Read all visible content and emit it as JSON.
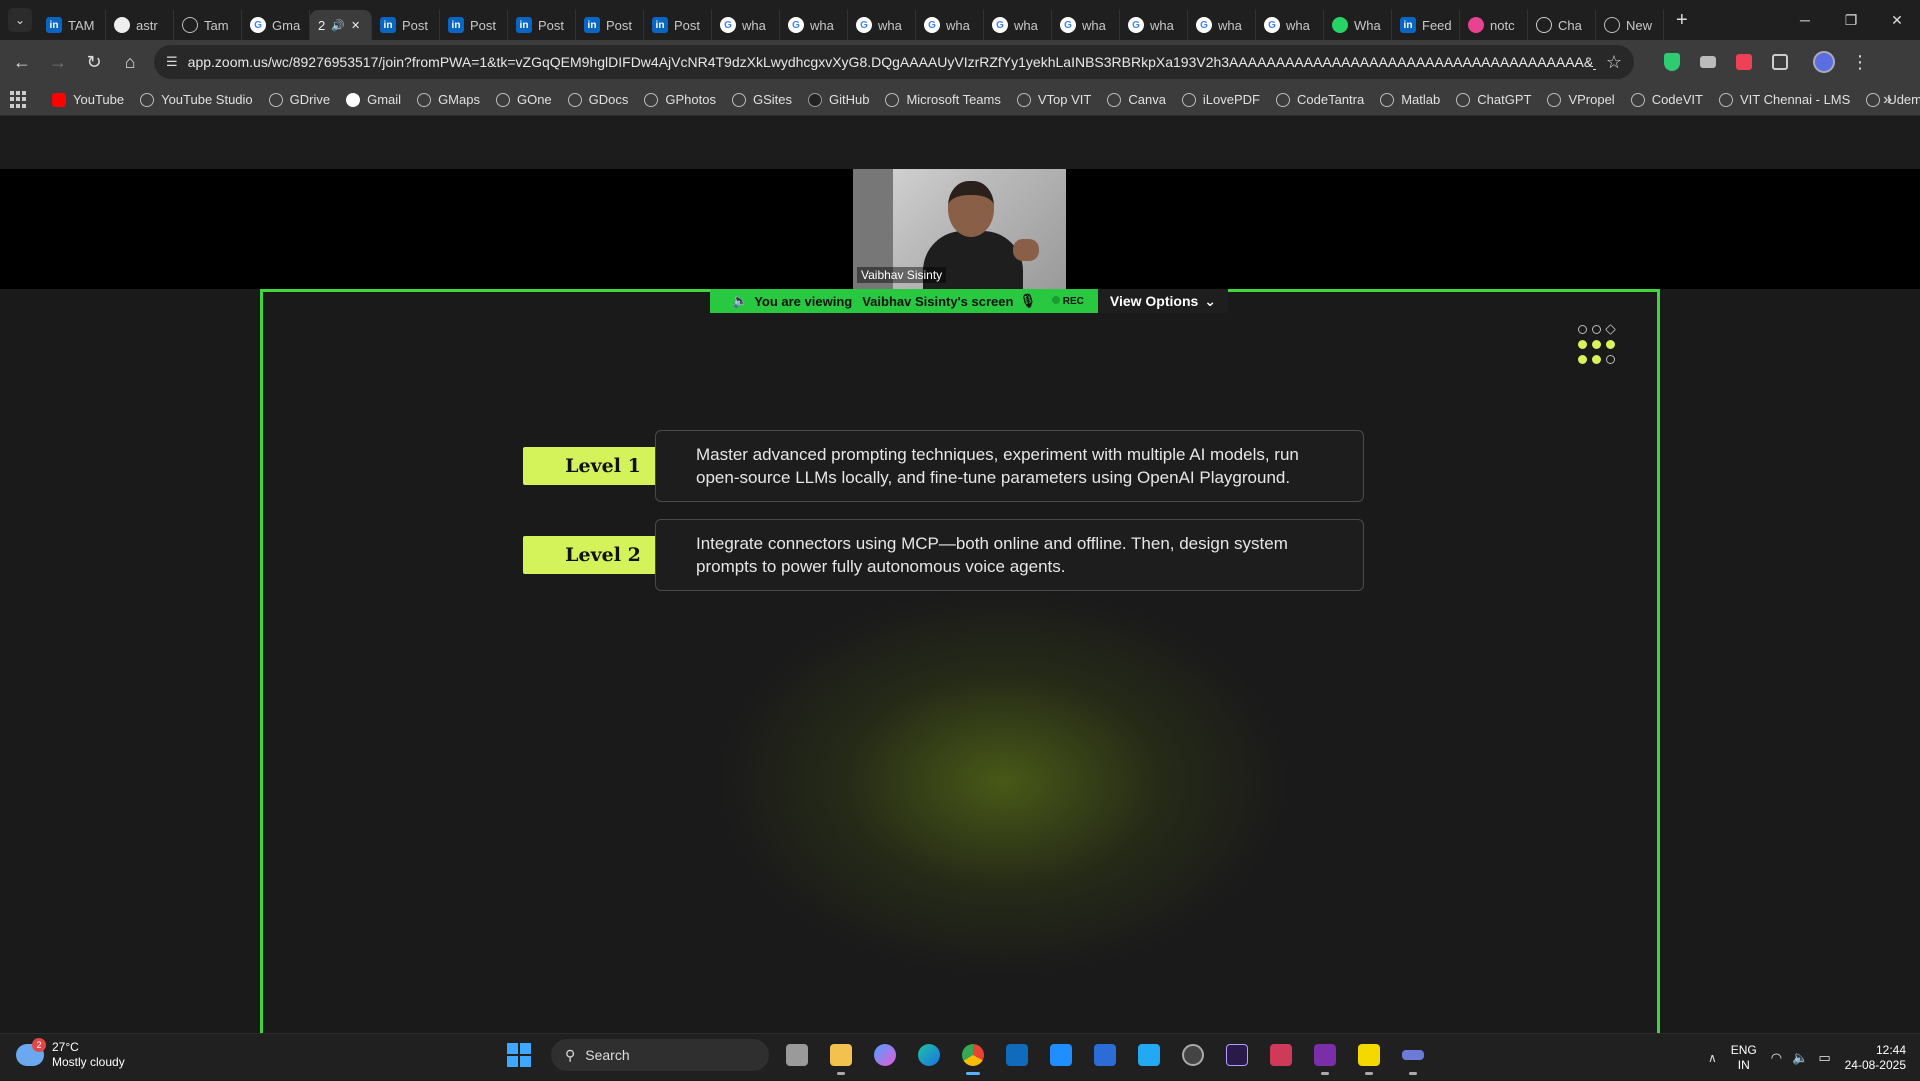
{
  "browser": {
    "tabs": [
      {
        "label": "TAM",
        "icon": "linkedin"
      },
      {
        "label": "astr",
        "icon": "github"
      },
      {
        "label": "Tam",
        "icon": "globe"
      },
      {
        "label": "Gma",
        "icon": "google"
      },
      {
        "label": "2",
        "icon": "audio",
        "active": true
      },
      {
        "label": "Post",
        "icon": "linkedin"
      },
      {
        "label": "Post",
        "icon": "linkedin"
      },
      {
        "label": "Post",
        "icon": "linkedin"
      },
      {
        "label": "Post",
        "icon": "linkedin"
      },
      {
        "label": "Post",
        "icon": "linkedin"
      },
      {
        "label": "wha",
        "icon": "google"
      },
      {
        "label": "wha",
        "icon": "google"
      },
      {
        "label": "wha",
        "icon": "google"
      },
      {
        "label": "wha",
        "icon": "google"
      },
      {
        "label": "wha",
        "icon": "google"
      },
      {
        "label": "wha",
        "icon": "google"
      },
      {
        "label": "wha",
        "icon": "google"
      },
      {
        "label": "wha",
        "icon": "google"
      },
      {
        "label": "wha",
        "icon": "google"
      },
      {
        "label": "Wha",
        "icon": "whatsapp"
      },
      {
        "label": "Feed",
        "icon": "linkedin"
      },
      {
        "label": "notc",
        "icon": "notion"
      },
      {
        "label": "Cha",
        "icon": "chatgpt"
      },
      {
        "label": "New",
        "icon": "globe"
      }
    ],
    "url": "app.zoom.us/wc/89276953517/join?fromPWA=1&tk=vZGqQEM9hglDIFDw4AjVcNR4T9dzXkLwydhcgxvXyG8.DQgAAAAUyVIzrRZfYy1yekhLaINBS3RBRkpXa193V2h3AAAAAAAAAAAAAAAAAAAAAAAAAAAAAAAAAAAAAA&_x_zm_r...",
    "bookmarks": [
      {
        "label": "YouTube",
        "icon": "youtube"
      },
      {
        "label": "YouTube Studio",
        "icon": "globe"
      },
      {
        "label": "GDrive",
        "icon": "globe"
      },
      {
        "label": "Gmail",
        "icon": "google"
      },
      {
        "label": "GMaps",
        "icon": "globe"
      },
      {
        "label": "GOne",
        "icon": "globe"
      },
      {
        "label": "GDocs",
        "icon": "globe"
      },
      {
        "label": "GPhotos",
        "icon": "globe"
      },
      {
        "label": "GSites",
        "icon": "globe"
      },
      {
        "label": "GitHub",
        "icon": "github"
      },
      {
        "label": "Microsoft Teams",
        "icon": "globe"
      },
      {
        "label": "VTop VIT",
        "icon": "globe"
      },
      {
        "label": "Canva",
        "icon": "globe"
      },
      {
        "label": "iLovePDF",
        "icon": "globe"
      },
      {
        "label": "CodeTantra",
        "icon": "globe"
      },
      {
        "label": "Matlab",
        "icon": "globe"
      },
      {
        "label": "ChatGPT",
        "icon": "chatgpt"
      },
      {
        "label": "VPropel",
        "icon": "globe"
      },
      {
        "label": "CodeVIT",
        "icon": "globe"
      },
      {
        "label": "VIT Chennai - LMS",
        "icon": "globe"
      },
      {
        "label": "Udemy",
        "icon": "globe"
      }
    ]
  },
  "zoom": {
    "participant_name": "Vaibhav Sisinty",
    "banner_prefix": "You are viewing",
    "banner_screen": "Vaibhav Sisinty's screen",
    "rec_label": "REC",
    "view_options": "View Options",
    "share_border_color": "#3fd63f"
  },
  "slide": {
    "accent": "#d4f25a",
    "levels": [
      {
        "label": "Level 1",
        "text": "Master advanced prompting techniques, experiment with multiple AI models, run open-source LLMs locally, and fine-tune parameters using OpenAI Playground."
      },
      {
        "label": "Level 2",
        "text": "Integrate connectors using MCP—both online and offline. Then, design system prompts to power fully autonomous voice agents."
      }
    ]
  },
  "taskbar": {
    "weather_temp": "27°C",
    "weather_desc": "Mostly cloudy",
    "weather_badge": "2",
    "search_label": "Search",
    "lang_line1": "ENG",
    "lang_line2": "IN",
    "time": "12:44",
    "date": "24-08-2025"
  }
}
